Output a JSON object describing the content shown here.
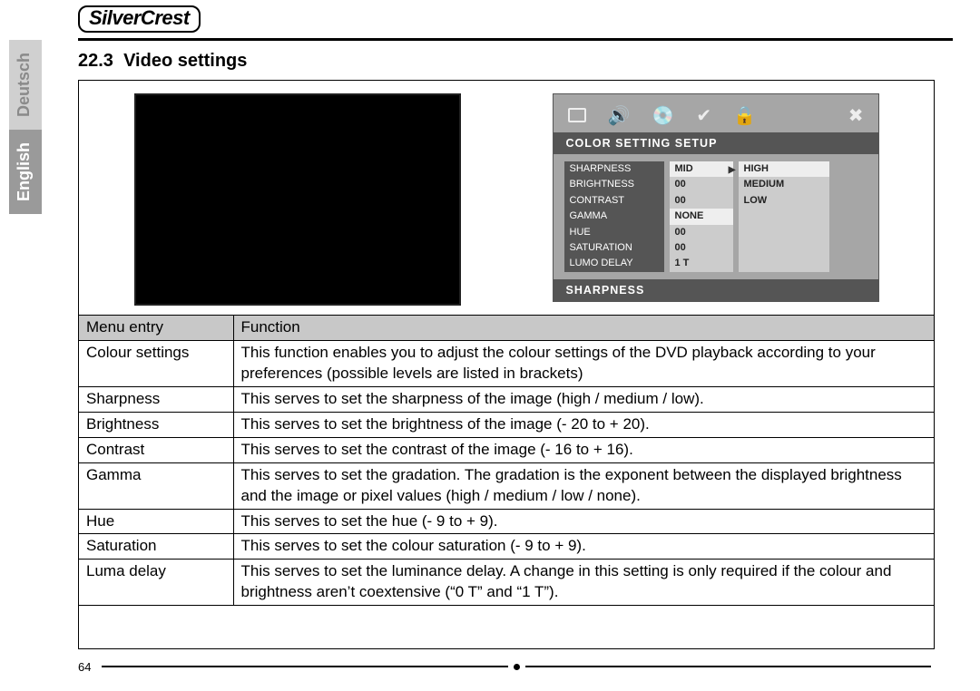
{
  "brand": "SilverCrest",
  "languages": {
    "de": "Deutsch",
    "en": "English"
  },
  "heading_num": "22.3",
  "heading_text": "Video settings",
  "page_number": "64",
  "osd": {
    "title": "COLOR SETTING SETUP",
    "footer": "SHARPNESS",
    "rows": [
      {
        "label": "SHARPNESS",
        "value": "MID"
      },
      {
        "label": "BRIGHTNESS",
        "value": "00"
      },
      {
        "label": "CONTRAST",
        "value": "00"
      },
      {
        "label": "GAMMA",
        "value": "NONE"
      },
      {
        "label": "HUE",
        "value": "00"
      },
      {
        "label": "SATURATION",
        "value": "00"
      },
      {
        "label": "LUMO DELAY",
        "value": "1 T"
      }
    ],
    "options": [
      "HIGH",
      "MEDIUM",
      "LOW"
    ]
  },
  "table": {
    "h1": "Menu entry",
    "h2": "Function",
    "rows": [
      {
        "entry": "Colour settings",
        "func": "This function enables you to adjust the colour settings of the DVD playback according to your preferences (possible levels are listed in brackets)",
        "justify": true
      },
      {
        "entry": "Sharpness",
        "func": "This serves to set the sharpness of the image (high / medium / low)."
      },
      {
        "entry": "Brightness",
        "func": "This serves to set the brightness of the image (- 20 to + 20)."
      },
      {
        "entry": "Contrast",
        "func": "This serves to set the contrast of the image (- 16 to + 16)."
      },
      {
        "entry": "Gamma",
        "func": "This serves to set the gradation. The gradation is the exponent between the displayed brightness and the image or pixel values (high / medium / low / none).",
        "justify": true
      },
      {
        "entry": "Hue",
        "func": "This serves to set the hue (- 9 to + 9)."
      },
      {
        "entry": "Saturation",
        "func": "This serves to set the colour saturation (- 9 to + 9)."
      },
      {
        "entry": "Luma delay",
        "func": "This serves to set the luminance delay. A change in this setting is only required if the colour and brightness aren’t coextensive (“0 T” and “1 T”).",
        "justify": true
      }
    ]
  }
}
